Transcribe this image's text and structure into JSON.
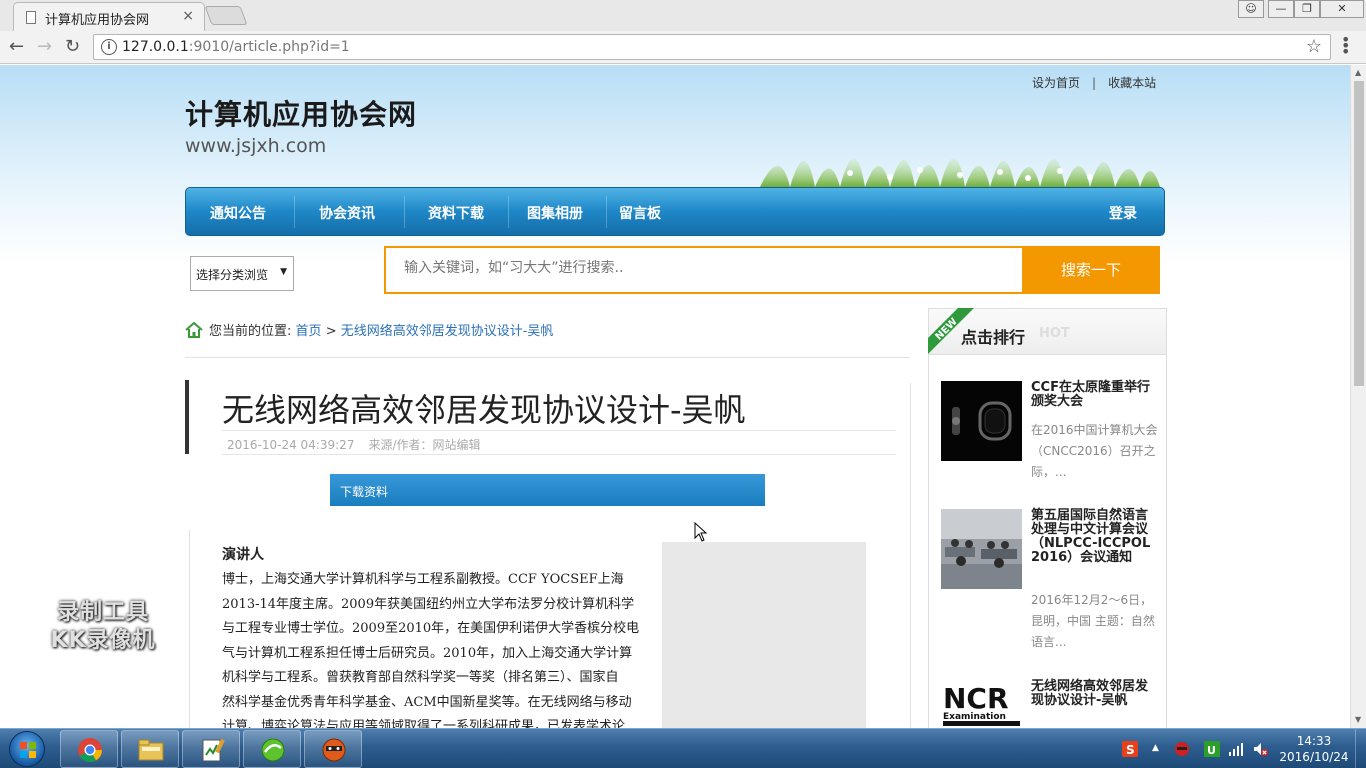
{
  "browser": {
    "tab_title": "计算机应用协会网",
    "tab_close": "×",
    "url_host": "127.0.0.1",
    "url_rest": ":9010/article.php?id=1"
  },
  "header": {
    "toplink_home": "设为首页",
    "toplink_sep": "|",
    "toplink_fav": "收藏本站",
    "site_title": "计算机应用协会网",
    "site_domain": "www.jsjxh.com"
  },
  "nav": {
    "items": [
      "通知公告",
      "协会资讯",
      "资料下载",
      "图集相册",
      "留言板"
    ],
    "login": "登录"
  },
  "search": {
    "category_label": "选择分类浏览",
    "placeholder": "输入关键词，如“习大大”进行搜索..",
    "button": "搜索一下"
  },
  "breadcrumb": {
    "prefix": "您当前的位置:",
    "home": "首页",
    "sep": ">",
    "current": "无线网络高效邻居发现协议设计-吴帆"
  },
  "article": {
    "title": "无线网络高效邻居发现协议设计-吴帆",
    "date": "2016-10-24 04:39:27",
    "source": "来源/作者：网站编辑",
    "download_label": "下载资料",
    "speaker_heading": "演讲人",
    "bio_lines": [
      "博士，上海交通大学计算机科学与工程系副教授。CCF YOCSEF上海",
      "2013-14年度主席。2009年获美国纽约州立大学布法罗分校计算机科学",
      "与工程专业博士学位。2009至2010年，在美国伊利诺伊大学香槟分校电",
      "气与计算机工程系担任博士后研究员。2010年，加入上海交通大学计算",
      "机科学与工程系。曾获教育部自然科学奖一等奖（排名第三）、国家自",
      "然科学基金优秀青年科学基金、ACM中国新星奖等。在无线网络与移动",
      "计算、博弈论算法与应用等领域取得了一系列科研成果，已发表学术论"
    ]
  },
  "sidebar": {
    "title": "点击排行",
    "hot_label": "HOT",
    "ribbon": "NEW",
    "items": [
      {
        "title": "CCF在太原隆重举行颁奖大会",
        "desc": "在2016中国计算机大会（CNCC2016）召开之际，..."
      },
      {
        "title": "第五届国际自然语言处理与中文计算会议（NLPCC-ICCPOL 2016）会议通知",
        "desc": "2016年12月2～6日，昆明，中国 主题：自然语言..."
      },
      {
        "title": "无线网络高效邻居发现协议设计-吴帆",
        "desc": ""
      }
    ],
    "thumb3_text": "NCR",
    "thumb3_sub": "Examination"
  },
  "watermark": {
    "line1": "录制工具",
    "line2": "KK录像机"
  },
  "taskbar": {
    "time": "14:33",
    "date": "2016/10/24"
  }
}
